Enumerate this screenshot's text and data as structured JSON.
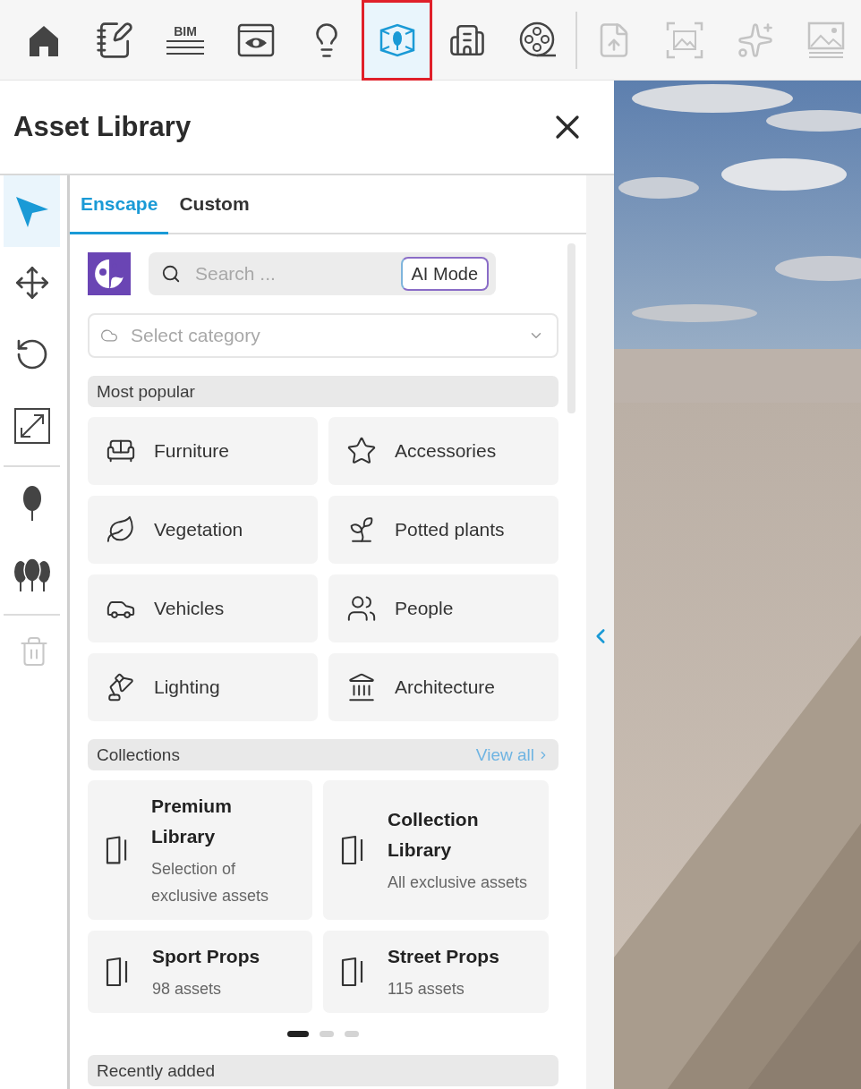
{
  "toolbar": {
    "items": [
      {
        "kind": "home",
        "selected": false,
        "disabled": false
      },
      {
        "kind": "notes",
        "selected": false,
        "disabled": false
      },
      {
        "kind": "bim",
        "label": "BIM",
        "selected": false,
        "disabled": false
      },
      {
        "kind": "view",
        "selected": false,
        "disabled": false
      },
      {
        "kind": "light",
        "selected": false,
        "disabled": false
      },
      {
        "kind": "assets",
        "selected": true,
        "disabled": false
      },
      {
        "kind": "building",
        "selected": false,
        "disabled": false
      },
      {
        "kind": "video",
        "selected": false,
        "disabled": false
      },
      {
        "kind": "separator"
      },
      {
        "kind": "upload",
        "selected": false,
        "disabled": true
      },
      {
        "kind": "capture",
        "selected": false,
        "disabled": true
      },
      {
        "kind": "ai-cloud",
        "selected": false,
        "disabled": true
      },
      {
        "kind": "gallery",
        "selected": false,
        "disabled": true
      }
    ]
  },
  "panel": {
    "title": "Asset Library",
    "tool_groups": [
      {
        "tools": [
          {
            "kind": "select",
            "selected": true,
            "disabled": false
          },
          {
            "kind": "move",
            "selected": false,
            "disabled": false
          },
          {
            "kind": "rotate",
            "selected": false,
            "disabled": false
          },
          {
            "kind": "scale",
            "selected": false,
            "disabled": false
          }
        ]
      },
      {
        "tools": [
          {
            "kind": "tree",
            "selected": false,
            "disabled": false
          },
          {
            "kind": "trees",
            "selected": false,
            "disabled": false
          }
        ]
      },
      {
        "tools": [
          {
            "kind": "delete",
            "selected": false,
            "disabled": true
          }
        ]
      }
    ],
    "tabs": [
      {
        "label": "Enscape",
        "selected": true
      },
      {
        "label": "Custom",
        "selected": false
      }
    ],
    "search": {
      "placeholder": "Search ...",
      "ai_button": "AI Mode"
    },
    "category_select": {
      "placeholder": "Select category"
    },
    "most_popular": {
      "title": "Most popular",
      "items": [
        {
          "kind": "sofa",
          "label": "Furniture"
        },
        {
          "kind": "star",
          "label": "Accessories"
        },
        {
          "kind": "leaf",
          "label": "Vegetation"
        },
        {
          "kind": "pot",
          "label": "Potted plants"
        },
        {
          "kind": "car",
          "label": "Vehicles"
        },
        {
          "kind": "people",
          "label": "People"
        },
        {
          "kind": "lamp",
          "label": "Lighting"
        },
        {
          "kind": "museum",
          "label": "Architecture"
        }
      ]
    },
    "collections": {
      "title": "Collections",
      "view_all": "View all",
      "items": [
        {
          "title": "Premium Library",
          "subtitle": "Selection of exclusive assets"
        },
        {
          "title": "Collection Library",
          "subtitle": "All exclusive assets"
        },
        {
          "title": "Sport Props",
          "subtitle": "98 assets"
        },
        {
          "title": "Street Props",
          "subtitle": "115 assets"
        }
      ],
      "pages": [
        {
          "selected": true
        },
        {
          "selected": false
        },
        {
          "selected": false
        }
      ]
    },
    "recently_added": {
      "title": "Recently added"
    }
  }
}
